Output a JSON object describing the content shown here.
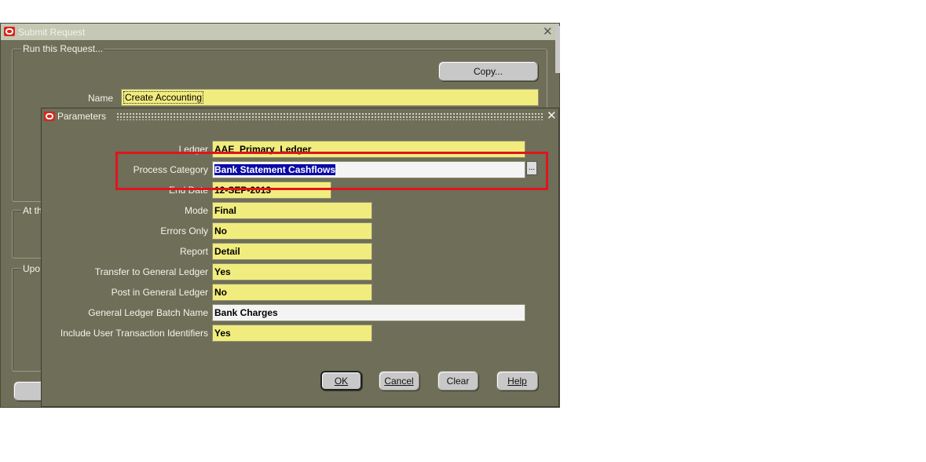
{
  "submit_request": {
    "title": "Submit Request",
    "group_run": "Run this Request...",
    "copy_button": "Copy...",
    "name_label": "Name",
    "name_value": "Create Accounting",
    "group_at": "At th",
    "group_upon": "Upo"
  },
  "parameters": {
    "title": "Parameters",
    "fields": [
      {
        "label": "Ledger",
        "value": "AAE_Primary_Ledger"
      },
      {
        "label": "Process Category",
        "value": "Bank Statement Cashflows"
      },
      {
        "label": "End Date",
        "value": "12-SEP-2013"
      },
      {
        "label": "Mode",
        "value": "Final"
      },
      {
        "label": "Errors Only",
        "value": "No"
      },
      {
        "label": "Report",
        "value": "Detail"
      },
      {
        "label": "Transfer to General Ledger",
        "value": "Yes"
      },
      {
        "label": "Post in General Ledger",
        "value": "No"
      },
      {
        "label": "General Ledger Batch Name",
        "value": "Bank Charges"
      },
      {
        "label": "Include User Transaction Identifiers",
        "value": "Yes"
      }
    ],
    "lov_button": "...",
    "buttons": {
      "ok": "OK",
      "cancel": "Cancel",
      "clear": "Clear",
      "help": "Help"
    }
  },
  "colors": {
    "window_bg": "#6e6e59",
    "required_field": "#f1ec7e",
    "highlight": "#e0141c",
    "selection": "#0a0aa8"
  }
}
